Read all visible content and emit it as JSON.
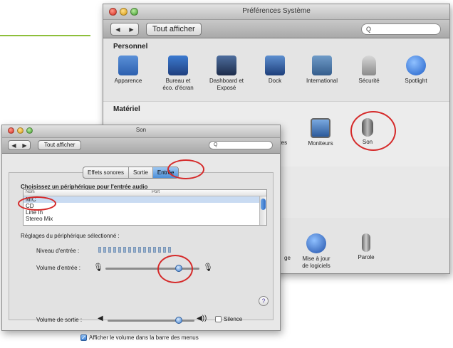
{
  "prefs": {
    "title": "Préférences Système",
    "show_all": "Tout afficher",
    "search_placeholder": "Q",
    "section_personnel": "Personnel",
    "section_materiel": "Matériel",
    "personnel": [
      {
        "label": "Apparence",
        "icon": "apparence-icon",
        "color": "#3a6fc0"
      },
      {
        "label": "Bureau et\néco. d'écran",
        "icon": "bureau-icon",
        "color": "#2d5aa0"
      },
      {
        "label": "Dashboard et\nExposé",
        "icon": "dashboard-icon",
        "color": "#3a4f7a"
      },
      {
        "label": "Dock",
        "icon": "dock-icon",
        "color": "#2c5d9a"
      },
      {
        "label": "International",
        "icon": "international-icon",
        "color": "#4a76a8"
      },
      {
        "label": "Sécurité",
        "icon": "securite-icon",
        "color": "#8a8a8a"
      },
      {
        "label": "Spotlight",
        "icon": "spotlight-icon",
        "color": "#2f6fd6"
      }
    ],
    "materiel_partial": "ntes",
    "moniteurs": "Moniteurs",
    "son": "Son",
    "lower_partial": "ge",
    "maj": "Mise à jour\nde logiciels",
    "parole": "Parole"
  },
  "son": {
    "title": "Son",
    "show_all": "Tout afficher",
    "search_placeholder": "Q",
    "tabs": [
      "Effets sonores",
      "Sortie",
      "Entrée"
    ],
    "choose_label": "Choisissez un périphérique pour l'entrée audio",
    "col_name": "Nom",
    "col_port": "Port",
    "devices": [
      "MIC",
      "CD",
      "Line In",
      "Stereo Mix"
    ],
    "settings_label": "Réglages du périphérique sélectionné :",
    "level_label": "Niveau d'entrée :",
    "input_volume_label": "Volume d'entrée :",
    "input_volume": 0.78,
    "output_volume_label": "Volume de sortie :",
    "output_volume": 0.82,
    "mute_label": "Silence",
    "mute_checked": false,
    "menu_label": "Afficher le volume dans la barre des menus",
    "menu_checked": true,
    "help": "?"
  }
}
